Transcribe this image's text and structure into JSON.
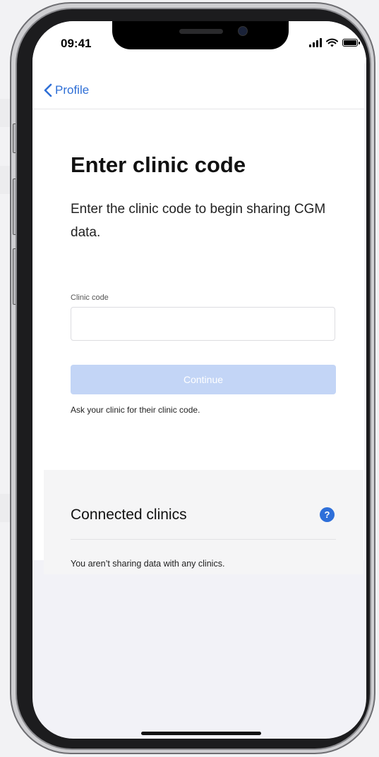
{
  "status_bar": {
    "time": "09:41",
    "signal_icon": "cellular-signal-icon",
    "wifi_icon": "wifi-icon",
    "battery_icon": "battery-icon"
  },
  "nav": {
    "back_label": "Profile",
    "back_icon": "chevron-left-icon"
  },
  "form": {
    "title": "Enter clinic code",
    "description": "Enter the clinic code to begin sharing CGM data.",
    "field_label": "Clinic code",
    "field_value": "",
    "continue_label": "Continue",
    "hint": "Ask your clinic for their clinic code."
  },
  "connected": {
    "title": "Connected clinics",
    "help_icon": "question-circle-icon",
    "help_glyph": "?",
    "empty_text": "You aren’t sharing data with any clinics."
  },
  "colors": {
    "accent": "#2f6fd6",
    "button_disabled": "#c3d5f6",
    "help_badge": "#2e6fd9"
  }
}
